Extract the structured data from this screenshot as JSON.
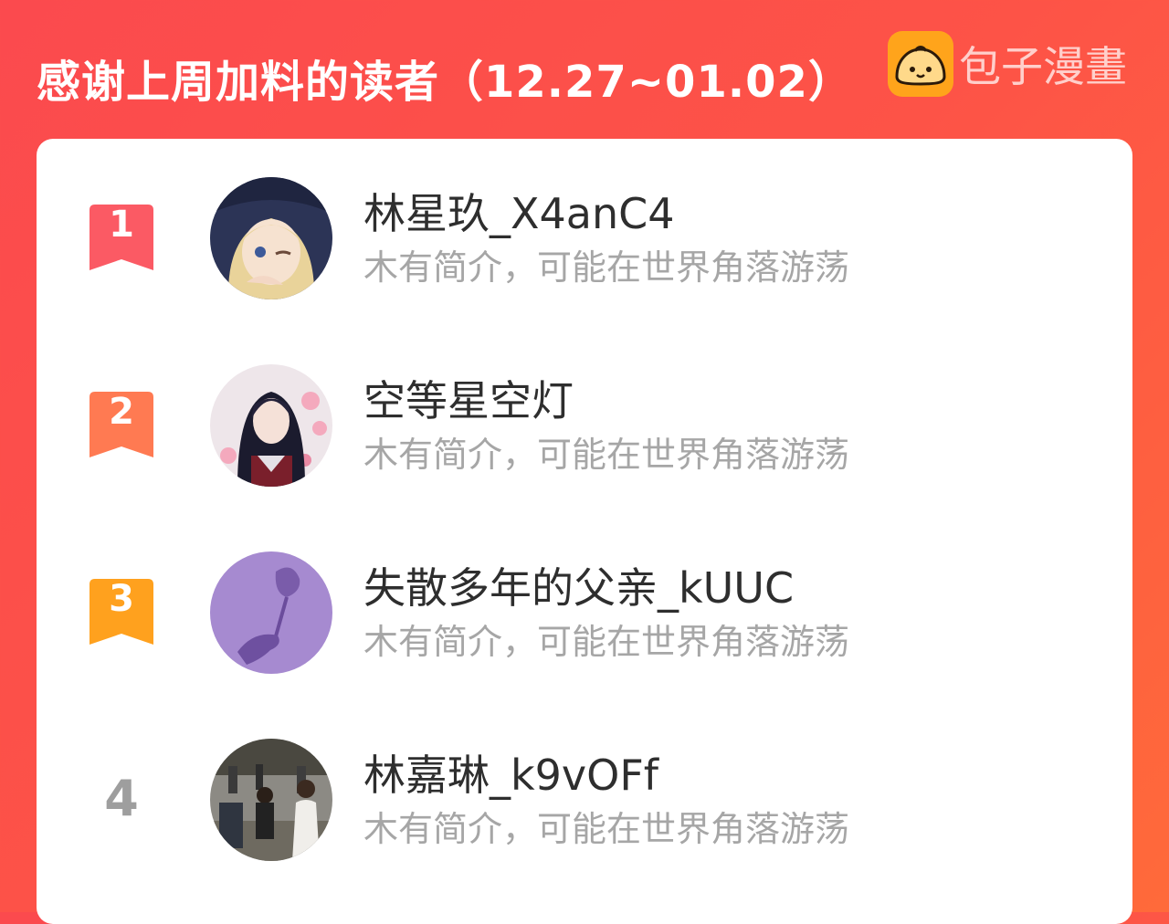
{
  "header": {
    "title": "感谢上周加料的读者（12.27~01.02）",
    "brand_name": "包子漫畫",
    "brand_icon": "baozi-bun-logo"
  },
  "colors": {
    "background_start": "#fb4a4e",
    "background_end": "#ff6a3a",
    "brand_logo": "#ffa41b",
    "rank_1": "#fb5a64",
    "rank_2": "#ff7a52",
    "rank_3": "#ffa11e",
    "rank_other": "#9e9e9e"
  },
  "readers": [
    {
      "rank": "1",
      "name": "林星玖_X4anC4",
      "bio": "木有简介，可能在世界角落游荡",
      "avatar_icon": "anime-girl-avatar"
    },
    {
      "rank": "2",
      "name": "空等星空灯",
      "bio": "木有简介，可能在世界角落游荡",
      "avatar_icon": "anime-boy-blossom-avatar"
    },
    {
      "rank": "3",
      "name": "失散多年的父亲_kUUC",
      "bio": "木有简介，可能在世界角落游荡",
      "avatar_icon": "purple-rose-hand-avatar"
    },
    {
      "rank": "4",
      "name": "林嘉琳_k9vOFf",
      "bio": "木有简介，可能在世界角落游荡",
      "avatar_icon": "street-kids-photo-avatar"
    }
  ]
}
